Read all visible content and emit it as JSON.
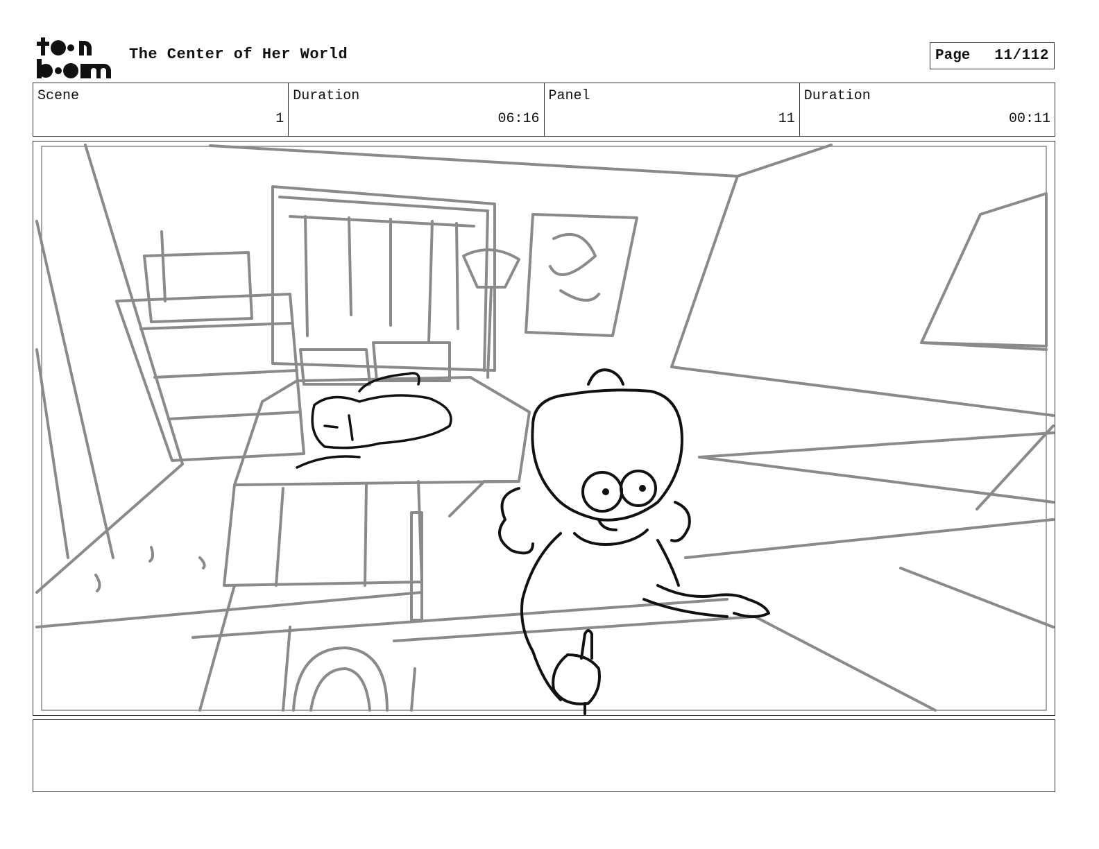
{
  "header": {
    "logo_text": "toon boom",
    "title": "The Center of Her World",
    "page_label": "Page",
    "page_value": "11/112"
  },
  "info": {
    "scene_label": "Scene",
    "scene_value": "1",
    "scene_duration_label": "Duration",
    "scene_duration_value": "06:16",
    "panel_label": "Panel",
    "panel_value": "11",
    "panel_duration_label": "Duration",
    "panel_duration_value": "00:11"
  },
  "notes": {
    "text": ""
  }
}
